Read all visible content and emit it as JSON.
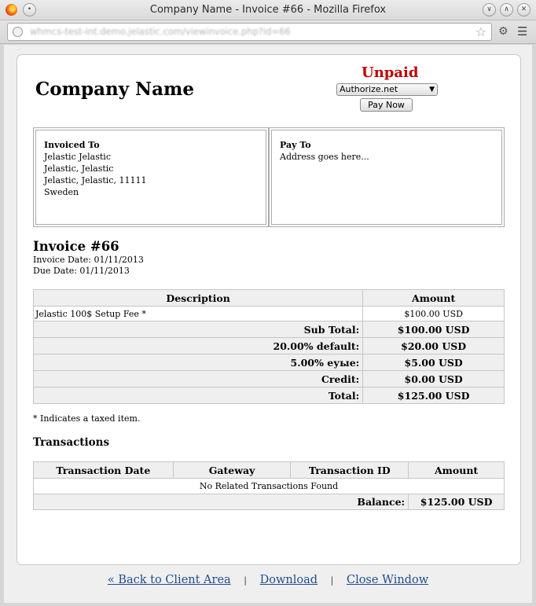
{
  "window": {
    "title": "Company Name - Invoice #66 - Mozilla Firefox",
    "url": "whmcs-test-int.demo.jelastic.com/viewinvoice.php?id=66"
  },
  "header": {
    "company_name": "Company Name",
    "status": "Unpaid",
    "gateway_selected": "Authorize.net",
    "pay_now_label": "Pay Now"
  },
  "invoiced_to": {
    "heading": "Invoiced To",
    "lines": [
      "Jelastic Jelastic",
      "Jelastic, Jelastic",
      "Jelastic, Jelastic, 11111",
      "Sweden"
    ]
  },
  "pay_to": {
    "heading": "Pay To",
    "address": "Address goes here..."
  },
  "invoice": {
    "title": "Invoice #66",
    "invoice_date": "Invoice Date: 01/11/2013",
    "due_date": "Due Date: 01/11/2013"
  },
  "items_table": {
    "headers": [
      "Description",
      "Amount"
    ],
    "items": [
      {
        "description": "Jelastic 100$ Setup Fee *",
        "amount": "$100.00 USD"
      }
    ],
    "summary": [
      {
        "label": "Sub Total:",
        "value": "$100.00 USD"
      },
      {
        "label": "20.00% default:",
        "value": "$20.00 USD"
      },
      {
        "label": "5.00% еуые:",
        "value": "$5.00 USD"
      },
      {
        "label": "Credit:",
        "value": "$0.00 USD"
      },
      {
        "label": "Total:",
        "value": "$125.00 USD"
      }
    ]
  },
  "tax_note": "* Indicates a taxed item.",
  "transactions": {
    "heading": "Transactions",
    "headers": [
      "Transaction Date",
      "Gateway",
      "Transaction ID",
      "Amount"
    ],
    "empty_message": "No Related Transactions Found",
    "balance_label": "Balance:",
    "balance_value": "$125.00 USD"
  },
  "footer": {
    "back_label": "« Back to Client Area",
    "separator": "|",
    "download_label": "Download",
    "close_label": "Close Window"
  }
}
